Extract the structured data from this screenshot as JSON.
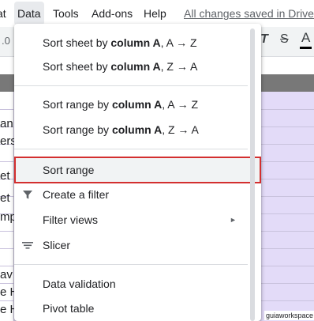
{
  "menubar": {
    "items": [
      "at",
      "Data",
      "Tools",
      "Add-ons",
      "Help"
    ],
    "saved_status": "All changes saved in Drive"
  },
  "toolbar": {
    "zoom_fragment": ".0",
    "icons": [
      "italic-icon",
      "strikethrough-icon",
      "text-color-icon"
    ],
    "italic_glyph": "T",
    "strike_glyph": "S",
    "text_color_glyph": "A",
    "text_color_swatch": "#000000"
  },
  "sheet": {
    "cells": [
      "an",
      "ers",
      "et",
      "et",
      "mp",
      "av",
      "e H",
      "e H"
    ]
  },
  "data_menu": {
    "items": [
      {
        "pre": "Sort sheet by ",
        "bold": "column A",
        "post": ", A → Z"
      },
      {
        "pre": "Sort sheet by ",
        "bold": "column A",
        "post": ", Z → A"
      },
      {
        "pre": "Sort range by ",
        "bold": "column A",
        "post": ", A → Z"
      },
      {
        "pre": "Sort range by ",
        "bold": "column A",
        "post": ", Z → A"
      },
      {
        "label": "Sort range",
        "highlighted": true
      },
      {
        "label": "Create a filter",
        "icon": "filter-icon"
      },
      {
        "label": "Filter views",
        "has_submenu": true
      },
      {
        "label": "Slicer",
        "icon": "slicer-icon"
      },
      {
        "label": "Data validation"
      },
      {
        "label": "Pivot table"
      }
    ],
    "submenu_glyph": "►"
  },
  "watermark": "guiaworkspace",
  "colors": {
    "menu_bg": "#ffffff",
    "highlight_border": "#d32f2f",
    "sheet_fill": "#e3dbf8",
    "header_fill": "#787878",
    "toolbar_fill": "#f1f3f4"
  }
}
